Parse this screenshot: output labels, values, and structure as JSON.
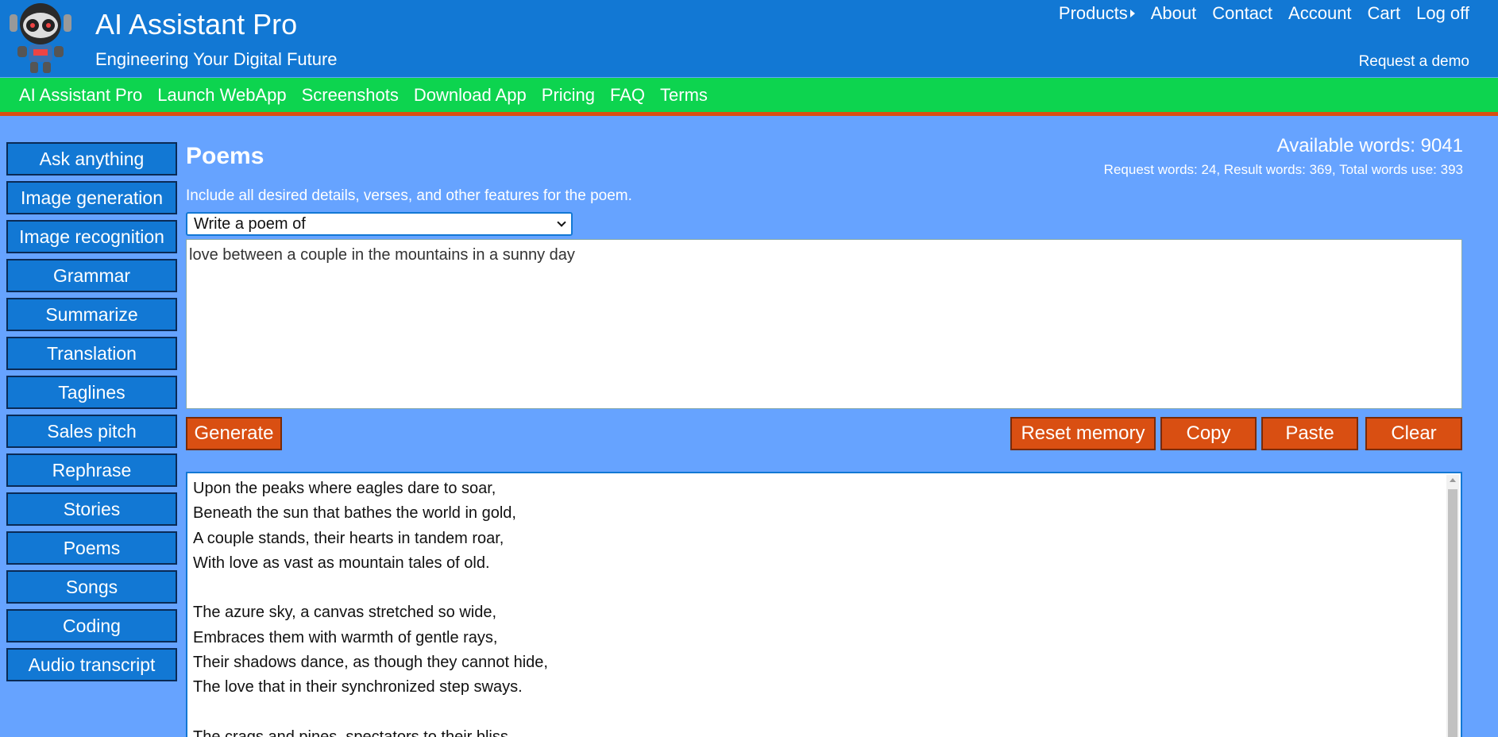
{
  "header": {
    "title": "AI Assistant Pro",
    "tagline": "Engineering Your Digital Future",
    "nav": [
      "Products",
      "About",
      "Contact",
      "Account",
      "Cart",
      "Log off"
    ],
    "request_demo": "Request a demo"
  },
  "menu": [
    "AI Assistant Pro",
    "Launch WebApp",
    "Screenshots",
    "Download App",
    "Pricing",
    "FAQ",
    "Terms"
  ],
  "sidebar": {
    "items": [
      "Ask anything",
      "Image generation",
      "Image recognition",
      "Grammar",
      "Summarize",
      "Translation",
      "Taglines",
      "Sales pitch",
      "Rephrase",
      "Stories",
      "Poems",
      "Songs",
      "Coding",
      "Audio transcript"
    ]
  },
  "main": {
    "title": "Poems",
    "available_words": "Available words: 9041",
    "usage": "Request words: 24, Result words: 369, Total words use: 393",
    "instructions": "Include all desired details, verses, and other features for the poem.",
    "select_value": "Write a poem of",
    "input_value": "love between a couple in the mountains in a sunny day",
    "buttons": {
      "generate": "Generate",
      "reset": "Reset memory",
      "copy": "Copy",
      "paste": "Paste",
      "clear": "Clear"
    },
    "output_lines": [
      "Upon the peaks where eagles dare to soar,",
      "Beneath the sun that bathes the world in gold,",
      "A couple stands, their hearts in tandem roar,",
      "With love as vast as mountain tales of old.",
      "",
      "The azure sky, a canvas stretched so wide,",
      "Embraces them with warmth of gentle rays,",
      "Their shadows dance, as though they cannot hide,",
      "The love that in their synchronized step sways.",
      "",
      "The crags and pines, spectators to their bliss,"
    ]
  },
  "colors": {
    "header_bg": "#1278d4",
    "menu_bg": "#0dd44f",
    "accent": "#d94f12",
    "page_bg": "#66a3ff"
  }
}
